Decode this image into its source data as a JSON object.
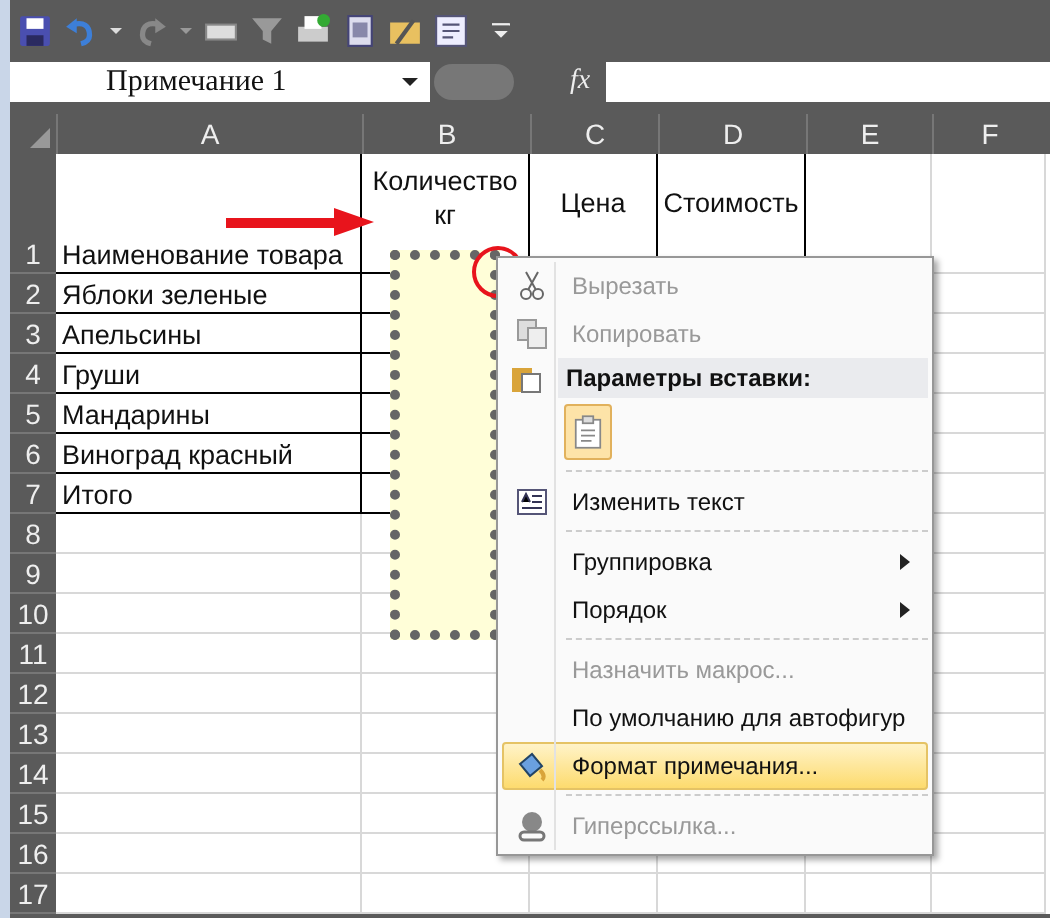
{
  "name_box": {
    "value": "Примечание 1"
  },
  "formula_bar": {
    "fx": "fx"
  },
  "columns": [
    "A",
    "B",
    "C",
    "D",
    "E",
    "F"
  ],
  "rows": [
    {
      "number": "1",
      "cells": [
        "Наименование товара",
        "Количество кг",
        "Цена",
        "Стоимость"
      ]
    },
    {
      "number": "2",
      "cells": [
        "Яблоки зеленые"
      ]
    },
    {
      "number": "3",
      "cells": [
        "Апельсины"
      ]
    },
    {
      "number": "4",
      "cells": [
        "Груши"
      ]
    },
    {
      "number": "5",
      "cells": [
        "Мандарины"
      ]
    },
    {
      "number": "6",
      "cells": [
        "Виноград красный"
      ]
    },
    {
      "number": "7",
      "cells": [
        "Итого"
      ]
    },
    {
      "number": "8",
      "cells": []
    },
    {
      "number": "9",
      "cells": []
    },
    {
      "number": "10",
      "cells": []
    },
    {
      "number": "11",
      "cells": []
    },
    {
      "number": "12",
      "cells": []
    },
    {
      "number": "13",
      "cells": []
    },
    {
      "number": "14",
      "cells": []
    },
    {
      "number": "15",
      "cells": []
    },
    {
      "number": "16",
      "cells": []
    },
    {
      "number": "17",
      "cells": []
    }
  ],
  "context_menu": [
    {
      "kind": "cut",
      "label": "Вырезать",
      "disabled": true,
      "selected": false
    },
    {
      "kind": "copy",
      "label": "Копировать",
      "disabled": true,
      "selected": false
    },
    {
      "kind": "header",
      "label": "Параметры вставки:"
    },
    {
      "kind": "paste"
    },
    {
      "kind": "separator"
    },
    {
      "kind": "edit",
      "label": "Изменить текст",
      "disabled": false,
      "selected": false
    },
    {
      "kind": "separator"
    },
    {
      "kind": "submenu",
      "label": "Группировка",
      "disabled": false,
      "selected": false
    },
    {
      "kind": "submenu",
      "label": "Порядок",
      "disabled": false,
      "selected": false
    },
    {
      "kind": "separator"
    },
    {
      "kind": "plain",
      "label": "Назначить макрос...",
      "disabled": true,
      "selected": false
    },
    {
      "kind": "plain",
      "label": "По умолчанию для автофигур",
      "disabled": false,
      "selected": false
    },
    {
      "kind": "format",
      "label": "Формат примечания...",
      "disabled": false,
      "selected": true
    },
    {
      "kind": "separator"
    },
    {
      "kind": "hyperlink",
      "label": "Гиперссылка...",
      "disabled": true,
      "selected": false
    }
  ]
}
